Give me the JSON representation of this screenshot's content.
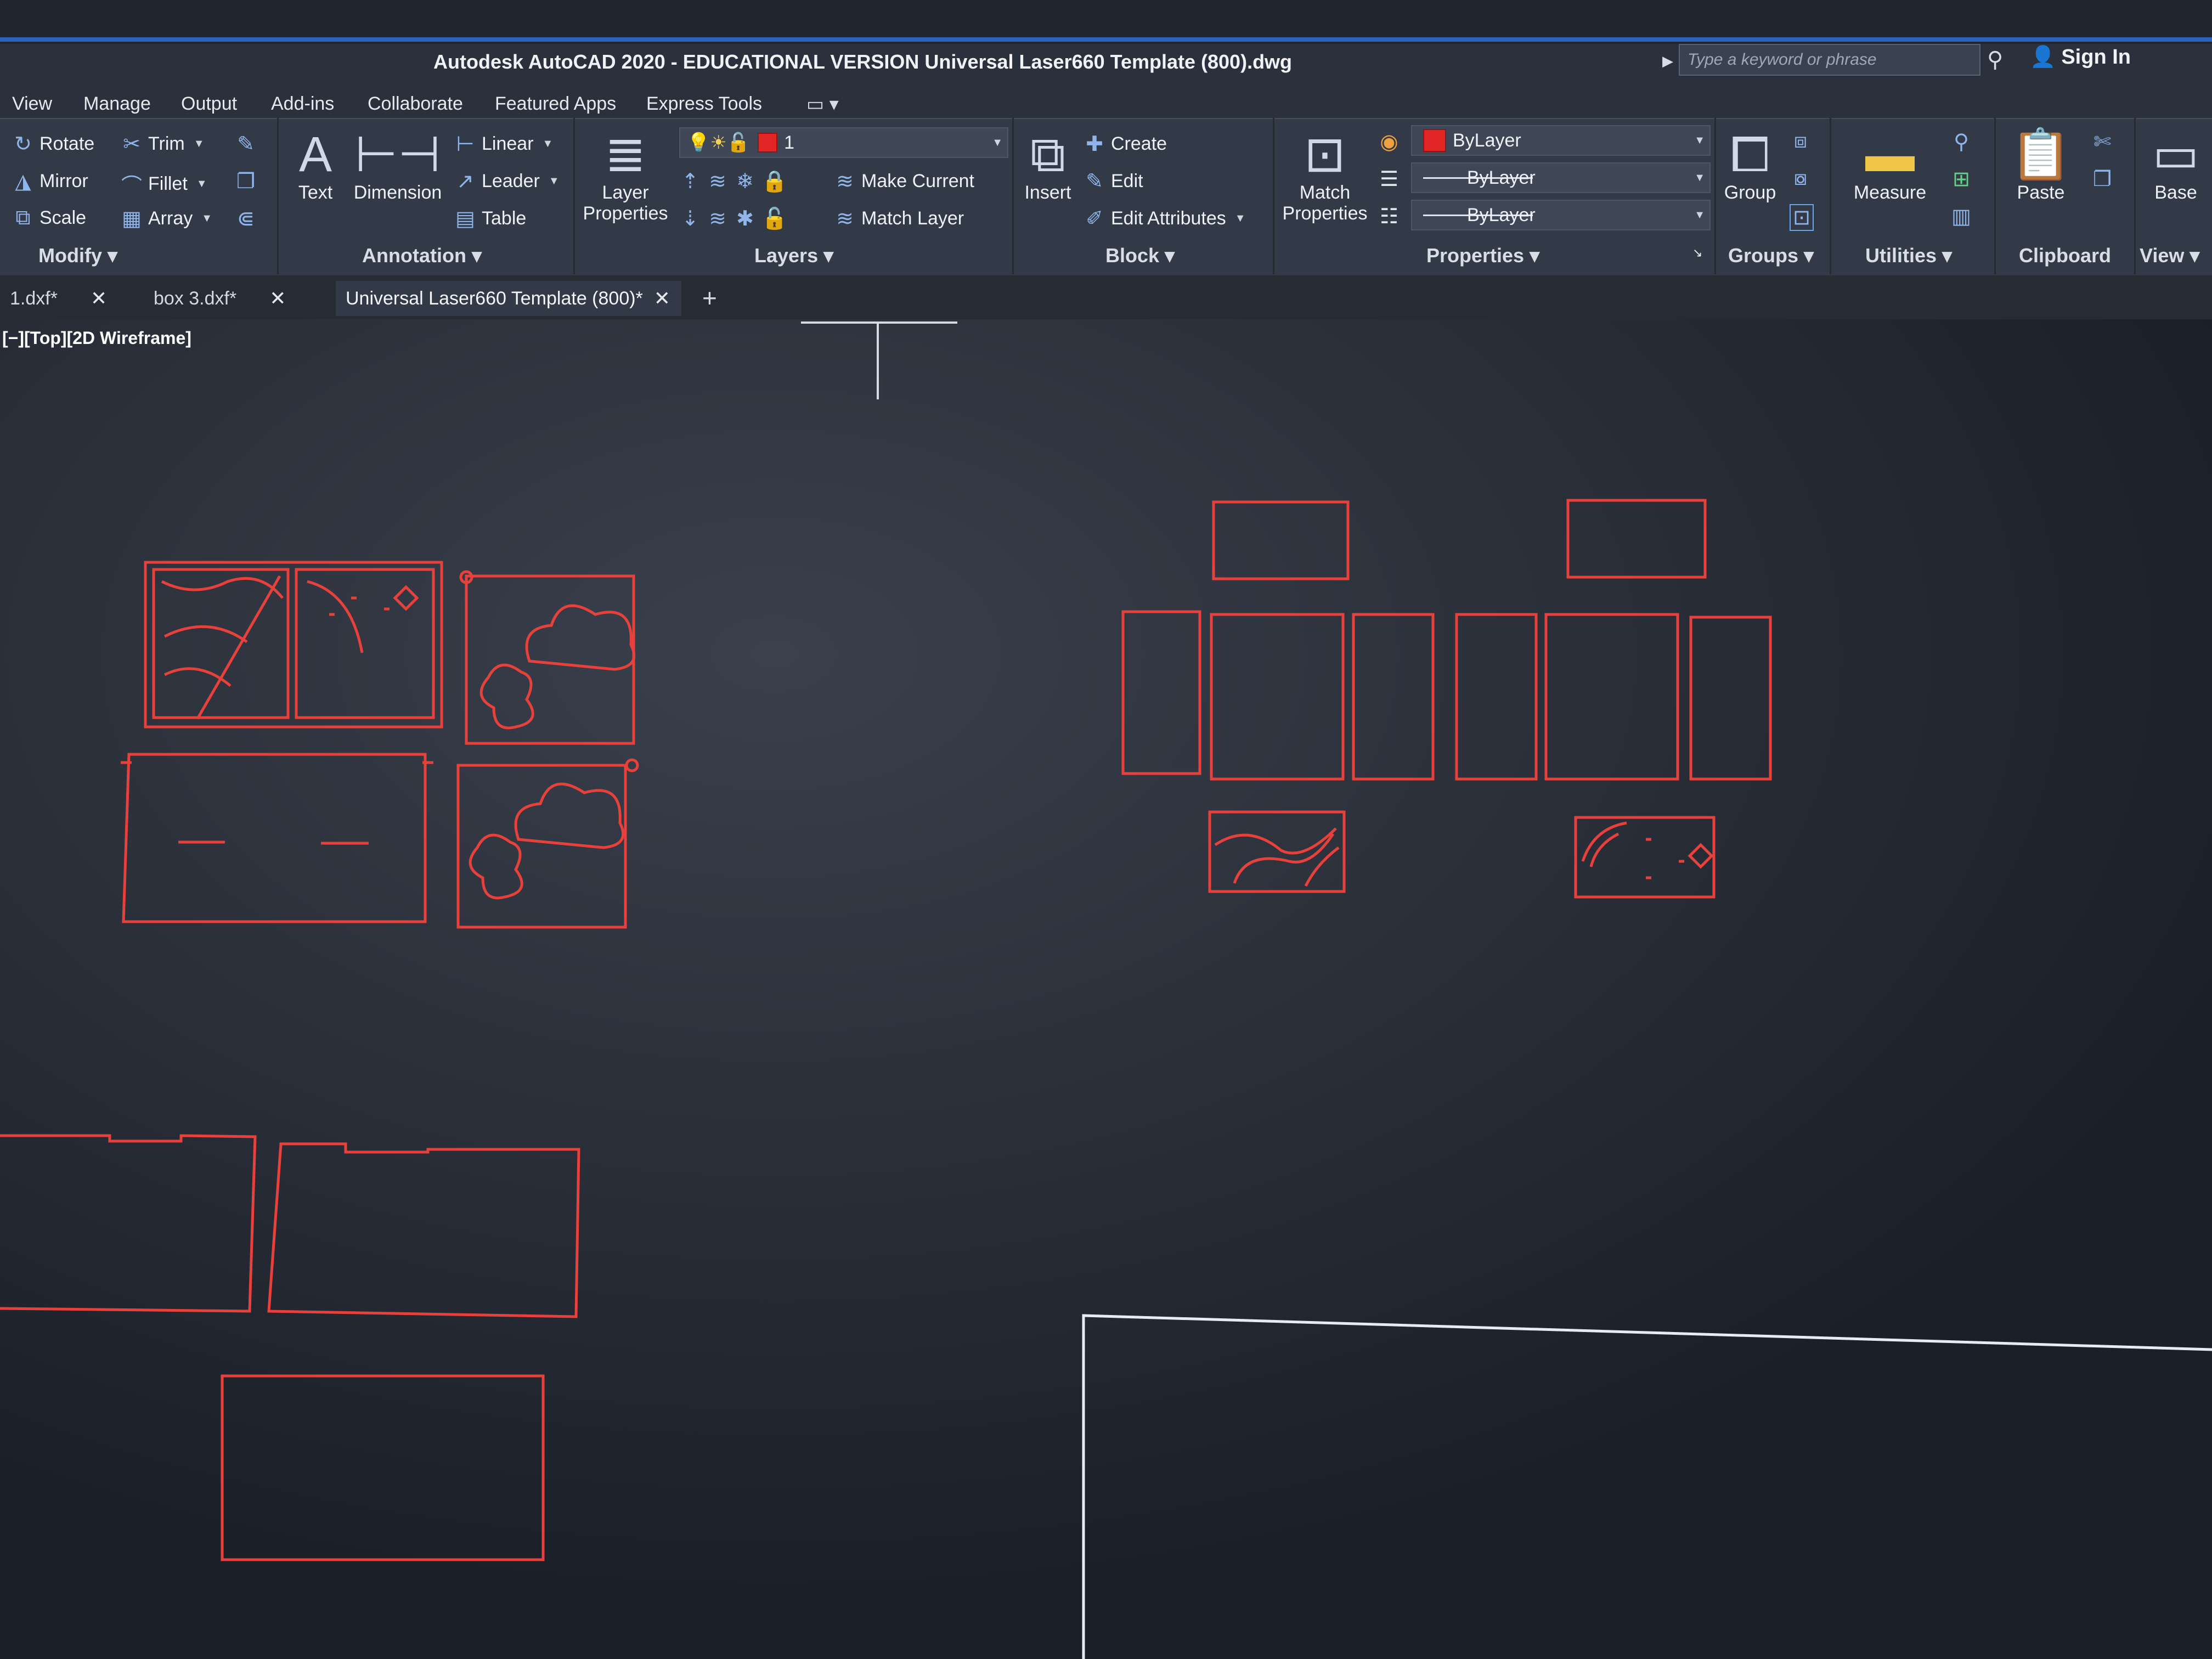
{
  "window": {
    "title": "Autodesk AutoCAD 2020 - EDUCATIONAL VERSION    Universal Laser660 Template (800).dwg",
    "search_placeholder": "Type a keyword or phrase",
    "sign_in": "Sign In"
  },
  "menu": [
    "View",
    "Manage",
    "Output",
    "Add-ins",
    "Collaborate",
    "Featured Apps",
    "Express Tools"
  ],
  "ribbon": {
    "modify": {
      "rotate": "Rotate",
      "trim": "Trim",
      "mirror": "Mirror",
      "fillet": "Fillet",
      "scale": "Scale",
      "array": "Array",
      "label": "Modify"
    },
    "annotation": {
      "text": "Text",
      "dimension": "Dimension",
      "linear": "Linear",
      "leader": "Leader",
      "table": "Table",
      "label": "Annotation"
    },
    "layers": {
      "layer_properties": "Layer Properties",
      "current_layer": "1",
      "make_current": "Make Current",
      "match_layer": "Match Layer",
      "label": "Layers"
    },
    "block": {
      "insert": "Insert",
      "create": "Create",
      "edit": "Edit",
      "edit_attributes": "Edit Attributes",
      "label": "Block"
    },
    "properties": {
      "match_properties": "Match Properties",
      "color": "ByLayer",
      "linetype": "ByLayer",
      "lineweight": "ByLayer",
      "label": "Properties",
      "color_hex": "#e22525"
    },
    "groups": {
      "group": "Group",
      "label": "Groups"
    },
    "utilities": {
      "measure": "Measure",
      "label": "Utilities"
    },
    "clipboard": {
      "paste": "Paste",
      "label": "Clipboard"
    },
    "view": {
      "base": "Base",
      "label": "View"
    }
  },
  "tabs": [
    {
      "label": "1.dxf*"
    },
    {
      "label": "box 3.dxf*"
    },
    {
      "label": "Universal Laser660 Template (800)*"
    }
  ],
  "viewport": {
    "label": "[−][Top][2D Wireframe]",
    "background": "#1b1f28",
    "cut_color": "#e8413b",
    "boundary_color": "#e8ecf2"
  }
}
